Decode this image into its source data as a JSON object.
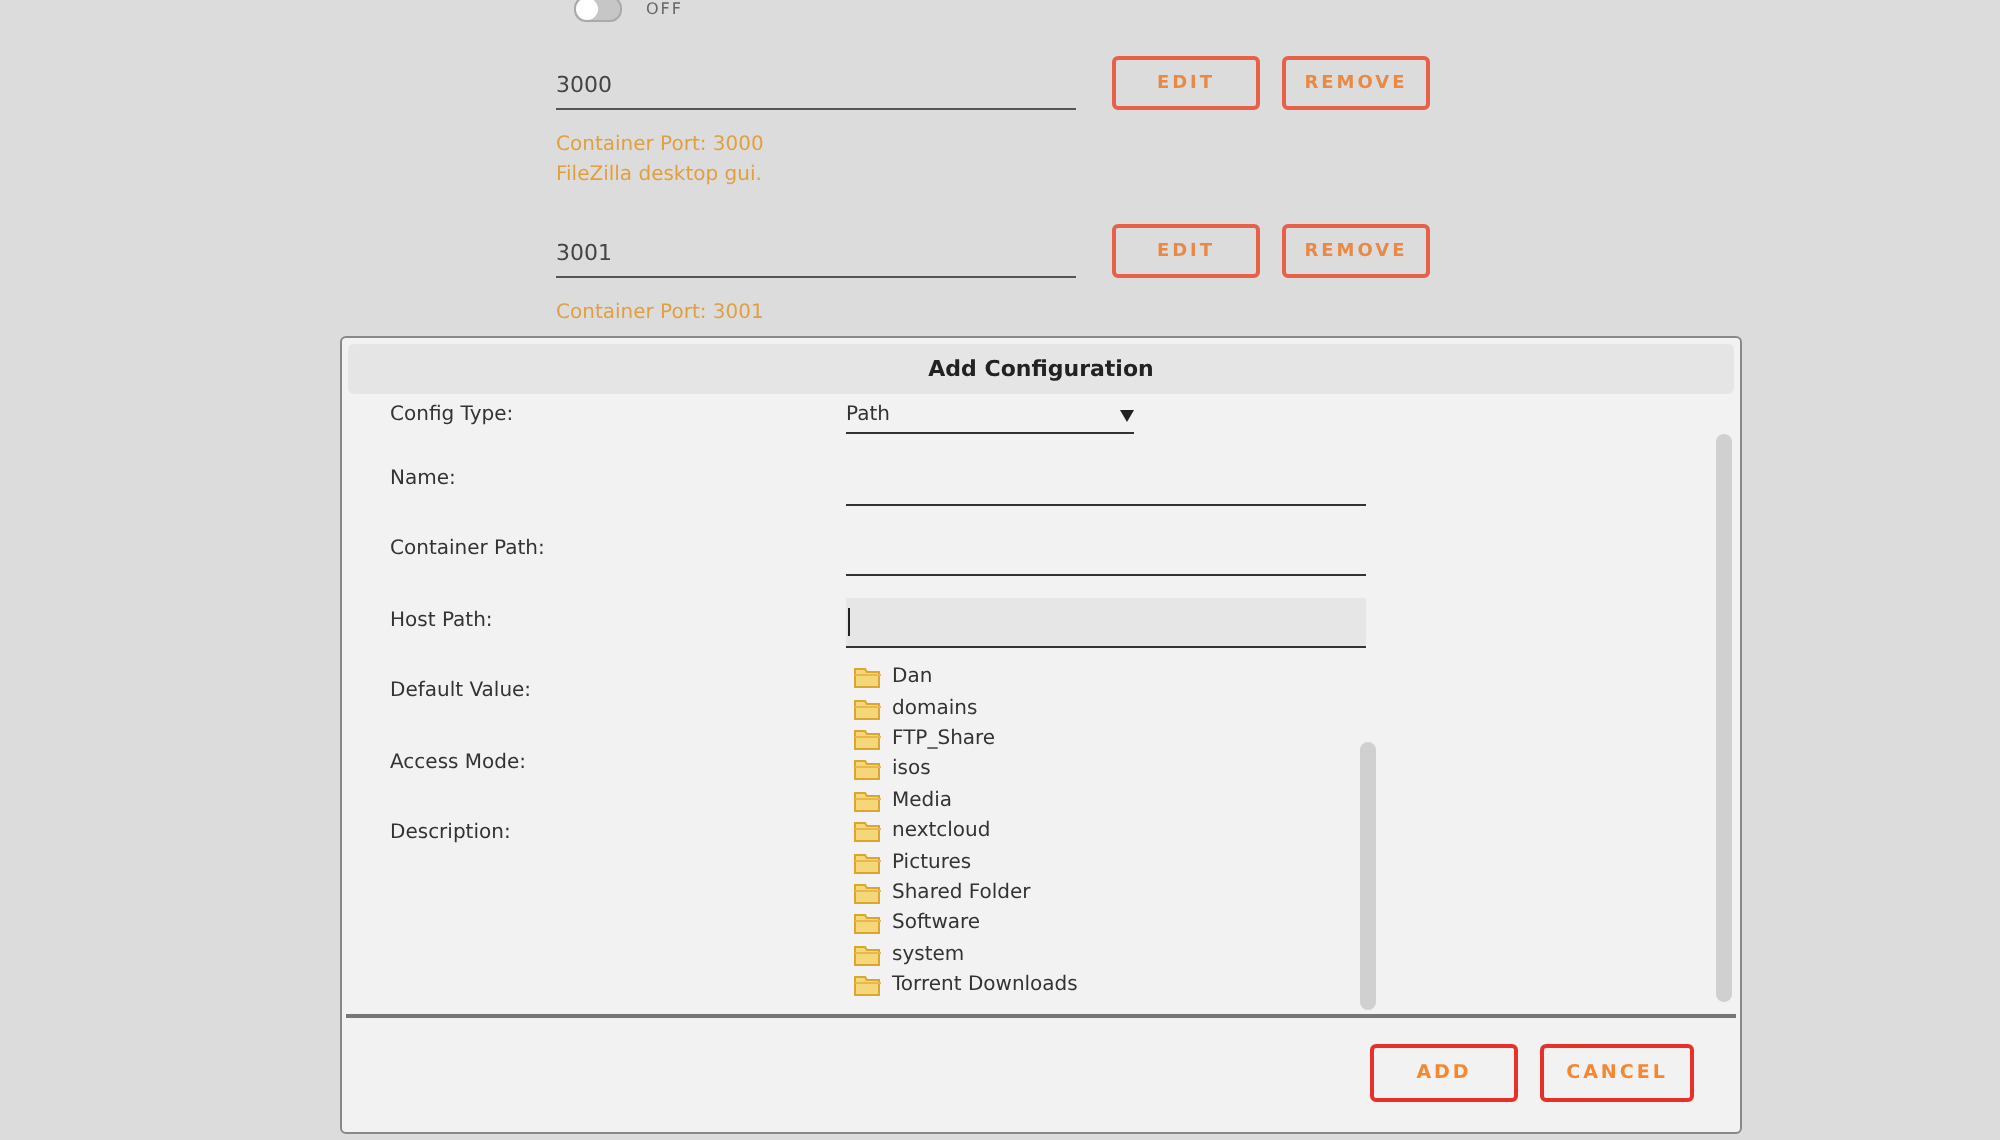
{
  "background": {
    "toggle": {
      "on": false,
      "label": "OFF"
    },
    "ports": [
      {
        "value": "3000",
        "buttons": [
          "EDIT",
          "REMOVE"
        ],
        "notes": [
          "Container Port: 3000",
          "FileZilla desktop gui."
        ]
      },
      {
        "value": "3001",
        "buttons": [
          "EDIT",
          "REMOVE"
        ],
        "notes": [
          "Container Port: 3001"
        ]
      }
    ]
  },
  "dialog": {
    "title": "Add Configuration",
    "fields": [
      {
        "label": "Config Type:",
        "kind": "select",
        "value": "Path"
      },
      {
        "label": "Name:",
        "kind": "text"
      },
      {
        "label": "Container Path:",
        "kind": "text"
      },
      {
        "label": "Host Path:",
        "kind": "active"
      },
      {
        "label": "Default Value:",
        "kind": "covered"
      },
      {
        "label": "Access Mode:",
        "kind": "covered"
      },
      {
        "label": "Description:",
        "kind": "covered"
      }
    ],
    "folder_list": [
      "Dan",
      "domains",
      "FTP_Share",
      "isos",
      "Media",
      "nextcloud",
      "Pictures",
      "Shared Folder",
      "Software",
      "system",
      "Torrent Downloads"
    ],
    "buttons": [
      "ADD",
      "CANCEL"
    ]
  }
}
